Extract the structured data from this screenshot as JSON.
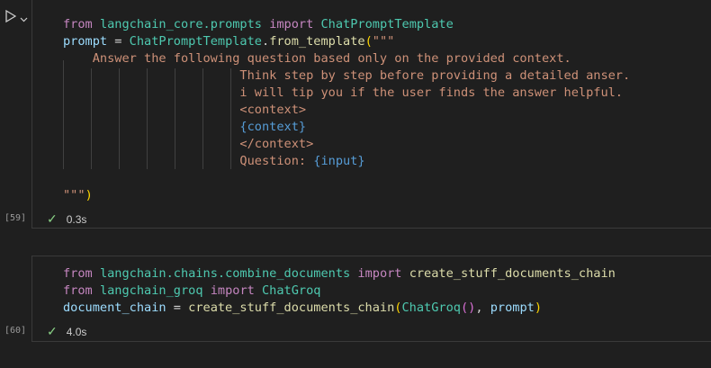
{
  "cells": [
    {
      "exec_count": "[59]",
      "duration": "0.3s",
      "lines": [
        [
          [
            "kw",
            "from"
          ],
          [
            "punc",
            " "
          ],
          [
            "mod",
            "langchain_core.prompts"
          ],
          [
            "punc",
            " "
          ],
          [
            "kw",
            "import"
          ],
          [
            "punc",
            " "
          ],
          [
            "cls",
            "ChatPromptTemplate"
          ]
        ],
        [
          [
            "var",
            "prompt"
          ],
          [
            "punc",
            " = "
          ],
          [
            "cls",
            "ChatPromptTemplate"
          ],
          [
            "punc",
            "."
          ],
          [
            "fn",
            "from_template"
          ],
          [
            "paren",
            "("
          ],
          [
            "str",
            "\"\"\""
          ]
        ],
        [
          [
            "str",
            "    Answer the following question based only on the provided context."
          ]
        ],
        [
          [
            "str",
            "                        Think step by step before providing a detailed anser."
          ]
        ],
        [
          [
            "str",
            "                        i will tip you if the user finds the answer helpful."
          ]
        ],
        [
          [
            "str",
            "                        <context>"
          ]
        ],
        [
          [
            "punc",
            "                        "
          ],
          [
            "ph",
            "{context}"
          ]
        ],
        [
          [
            "str",
            "                        </context>"
          ]
        ],
        [
          [
            "str",
            "                        Question: "
          ],
          [
            "ph",
            "{input}"
          ]
        ],
        [
          [
            "punc",
            ""
          ]
        ],
        [
          [
            "str",
            "\"\"\""
          ],
          [
            "paren",
            ")"
          ]
        ]
      ]
    },
    {
      "exec_count": "[60]",
      "duration": "4.0s",
      "lines": [
        [
          [
            "kw",
            "from"
          ],
          [
            "punc",
            " "
          ],
          [
            "mod",
            "langchain.chains.combine_documents"
          ],
          [
            "punc",
            " "
          ],
          [
            "kw",
            "import"
          ],
          [
            "punc",
            " "
          ],
          [
            "fn",
            "create_stuff_documents_chain"
          ]
        ],
        [
          [
            "kw",
            "from"
          ],
          [
            "punc",
            " "
          ],
          [
            "mod",
            "langchain_groq"
          ],
          [
            "punc",
            " "
          ],
          [
            "kw",
            "import"
          ],
          [
            "punc",
            " "
          ],
          [
            "cls",
            "ChatGroq"
          ]
        ],
        [
          [
            "var",
            "document_chain"
          ],
          [
            "punc",
            " = "
          ],
          [
            "fn",
            "create_stuff_documents_chain"
          ],
          [
            "paren",
            "("
          ],
          [
            "cls",
            "ChatGroq"
          ],
          [
            "paren2",
            "()"
          ],
          [
            "punc",
            ", "
          ],
          [
            "var",
            "prompt"
          ],
          [
            "paren",
            ")"
          ]
        ]
      ]
    }
  ],
  "icons": {
    "run": "run-cell-icon",
    "dropdown": "chevron-down-icon",
    "check": "checkmark-icon"
  },
  "colors": {
    "keyword": "#c586c0",
    "module": "#4ec9b0",
    "function": "#dcdcaa",
    "variable": "#9cdcfe",
    "string": "#ce9178",
    "placeholder": "#569cd6",
    "success": "#89d185",
    "background": "#1f1f1f"
  }
}
